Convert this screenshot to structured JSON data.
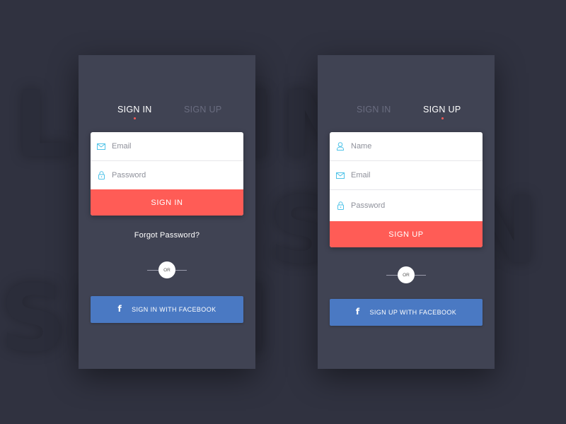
{
  "background": {
    "word1": "LOGIN",
    "word2": "SIGN UP",
    "word3": "SIGN"
  },
  "colors": {
    "page_bg": "#303240",
    "panel_bg": "#404353",
    "accent_red": "#ff5c56",
    "facebook_blue": "#4a79c3",
    "icon_teal": "#4fc3e8"
  },
  "signin_screen": {
    "tabs": {
      "signin": "SIGN IN",
      "signup": "SIGN UP",
      "active": "signin"
    },
    "email": {
      "placeholder": "Email",
      "icon": "mail-icon"
    },
    "password": {
      "placeholder": "Password",
      "icon": "lock-icon"
    },
    "submit_label": "SIGN IN",
    "forgot_label": "Forgot Password?",
    "or_label": "OR",
    "facebook_label": "SIGN IN WITH FACEBOOK",
    "facebook_icon": "f"
  },
  "signup_screen": {
    "tabs": {
      "signin": "SIGN IN",
      "signup": "SIGN UP",
      "active": "signup"
    },
    "name": {
      "placeholder": "Name",
      "icon": "user-icon"
    },
    "email": {
      "placeholder": "Email",
      "icon": "mail-icon"
    },
    "password": {
      "placeholder": "Password",
      "icon": "lock-icon"
    },
    "submit_label": "SIGN UP",
    "or_label": "OR",
    "facebook_label": "SIGN UP WITH FACEBOOK",
    "facebook_icon": "f"
  }
}
